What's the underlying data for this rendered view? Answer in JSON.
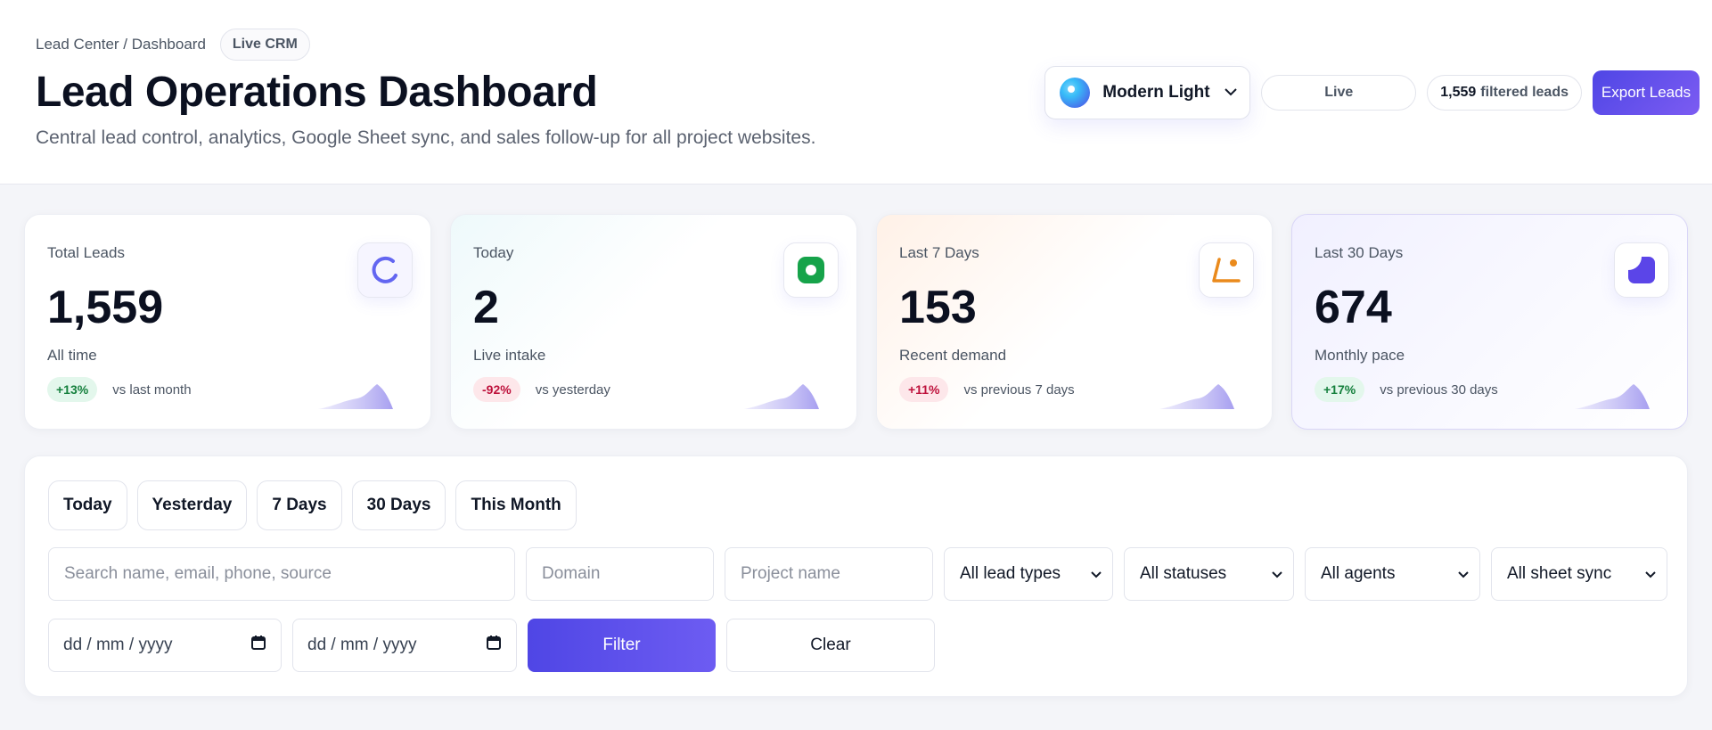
{
  "header": {
    "breadcrumb": "Lead Center / Dashboard",
    "crm_badge": "Live CRM",
    "title": "Lead Operations Dashboard",
    "subtitle": "Central lead control, analytics, Google Sheet sync, and sales follow-up for all project websites.",
    "theme_label": "Modern Light",
    "live_pill": "Live",
    "filtered_count": "1,559",
    "filtered_suffix": "filtered leads",
    "export_label": "Export Leads"
  },
  "cards": [
    {
      "label": "Total Leads",
      "value": "1,559",
      "sub": "All time",
      "delta": "+13%",
      "delta_dir": "up",
      "compare": "vs last month",
      "icon": "spinner-icon",
      "color": "#6366f1"
    },
    {
      "label": "Today",
      "value": "2",
      "sub": "Live intake",
      "delta": "-92%",
      "delta_dir": "down",
      "compare": "vs yesterday",
      "icon": "record-icon",
      "color": "#16a34a"
    },
    {
      "label": "Last 7 Days",
      "value": "153",
      "sub": "Recent demand",
      "delta": "+11%",
      "delta_dir": "down",
      "compare": "vs previous 7 days",
      "icon": "trend-icon",
      "color": "#ea8a1c"
    },
    {
      "label": "Last 30 Days",
      "value": "674",
      "sub": "Monthly pace",
      "delta": "+17%",
      "delta_dir": "up",
      "compare": "vs previous 30 days",
      "icon": "pie-icon",
      "color": "#5b45e8"
    }
  ],
  "filters": {
    "quick": [
      "Today",
      "Yesterday",
      "7 Days",
      "30 Days",
      "This Month"
    ],
    "search_placeholder": "Search name, email, phone, source",
    "domain_placeholder": "Domain",
    "project_placeholder": "Project name",
    "lead_type": "All lead types",
    "status": "All statuses",
    "agent": "All agents",
    "sheet_sync": "All sheet sync",
    "date_from_placeholder": "dd / mm / yyyy",
    "date_to_placeholder": "dd / mm / yyyy",
    "filter_label": "Filter",
    "clear_label": "Clear"
  }
}
